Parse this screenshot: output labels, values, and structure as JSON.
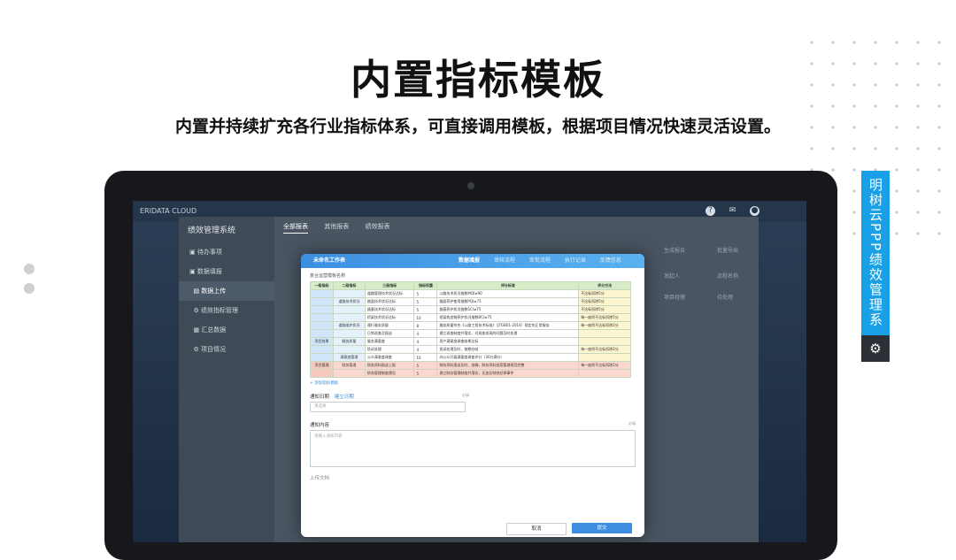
{
  "page": {
    "title": "内置指标模板",
    "subtitle": "内置并持续扩充各行业指标体系，可直接调用模板，根据项目情况快速灵活设置。",
    "side_tag": "明树云PPP绩效管理系统",
    "side_icon": "gear-icon"
  },
  "app": {
    "brand": "ERIDATA CLOUD",
    "system_name": "绩效管理系统",
    "sidebar": [
      {
        "label": "待办事项",
        "icon": "folder-icon"
      },
      {
        "label": "数据填报",
        "icon": "folder-icon"
      },
      {
        "label": "数据上传",
        "icon": "doc-icon",
        "active": true
      },
      {
        "label": "绩效指标管理",
        "icon": "gear-icon"
      },
      {
        "label": "汇总数据",
        "icon": "table-icon"
      },
      {
        "label": "项目情况",
        "icon": "gear-icon"
      }
    ],
    "tabs": [
      "全部报表",
      "其他报表",
      "绩效报表"
    ],
    "bg_columns": [
      "发起人",
      "流程名称"
    ],
    "bg_row": [
      "项目经理",
      "待处理"
    ],
    "top_buttons": [
      "生成报告",
      "批量导出"
    ]
  },
  "dialog": {
    "title": "未命名工作表",
    "steps": [
      "数据填报",
      "审核流程",
      "审批流程",
      "执行记录",
      "反馈信息"
    ],
    "current_step": 0,
    "table_caption": "复合运营模板名称",
    "table_headers": [
      "一级指标",
      "二级指标",
      "三级指标",
      "指标权重",
      "评分标准",
      "评分方法"
    ],
    "table_rows": [
      [
        "",
        "",
        "道路管理技术状况达标",
        "5",
        "公路技术状况指数MQI≥90",
        "不达标扣除5分"
      ],
      [
        "",
        "道路技术状况",
        "路面技术状况达标",
        "5",
        "路面养护使用指数PQI≥75",
        "不达标扣除5分"
      ],
      [
        "",
        "",
        "路基技术状况达标",
        "5",
        "路基养护状况指数SCI≥75",
        "不达标扣除5分"
      ],
      [
        "",
        "",
        "桥梁技术状况达标",
        "10",
        "桥梁构造物养护状况指数BCI≥75",
        "每一座桥不达标扣除5分"
      ],
      [
        "",
        "道路维护状况",
        "通行服务质量",
        "8",
        "服务质量符合《公路工程技术标准》（JTGB01-2014）规定的正常服务",
        "每一座桥不达标扣除2分"
      ],
      [
        "",
        "",
        "日常巡查及报送",
        "4",
        "建立巡查制度并落实，对巡查发现的问题及时处理",
        ""
      ],
      [
        "项目效果",
        "服务质量",
        "服务满意度",
        "4",
        "用户满意度调查结果达标",
        ""
      ],
      [
        "",
        "",
        "投诉处理",
        "4",
        "投诉处理及时，按期办结",
        "每一座桥不达标扣除2分"
      ],
      [
        "",
        "满意度管理",
        "公众满意度调查",
        "10",
        "向公众开展满意度调查评分（30分满分）",
        ""
      ],
      [
        "项目管理",
        "财务管理",
        "财务资料报送上报",
        "5",
        "财务资料报送及时、准确，财务资料档案管理规范完整",
        "每一座桥不达标扣除2分"
      ],
      [
        "",
        "",
        "财务管理制度建设",
        "5",
        "建立财务管理制度并落实，无违反财经纪律事件",
        ""
      ]
    ],
    "add_link": "+ 添加指标模板",
    "notify_date_label": "通知日期",
    "notify_date_link": "建立日期",
    "notify_date_placeholder": "请选择",
    "notify_date_hint": "必填",
    "notify_content_label": "通知内容",
    "notify_content_placeholder": "请输入通知内容",
    "notify_content_hint": "必填",
    "upload_label": "上传文档",
    "cancel": "取消",
    "submit": "提交"
  }
}
